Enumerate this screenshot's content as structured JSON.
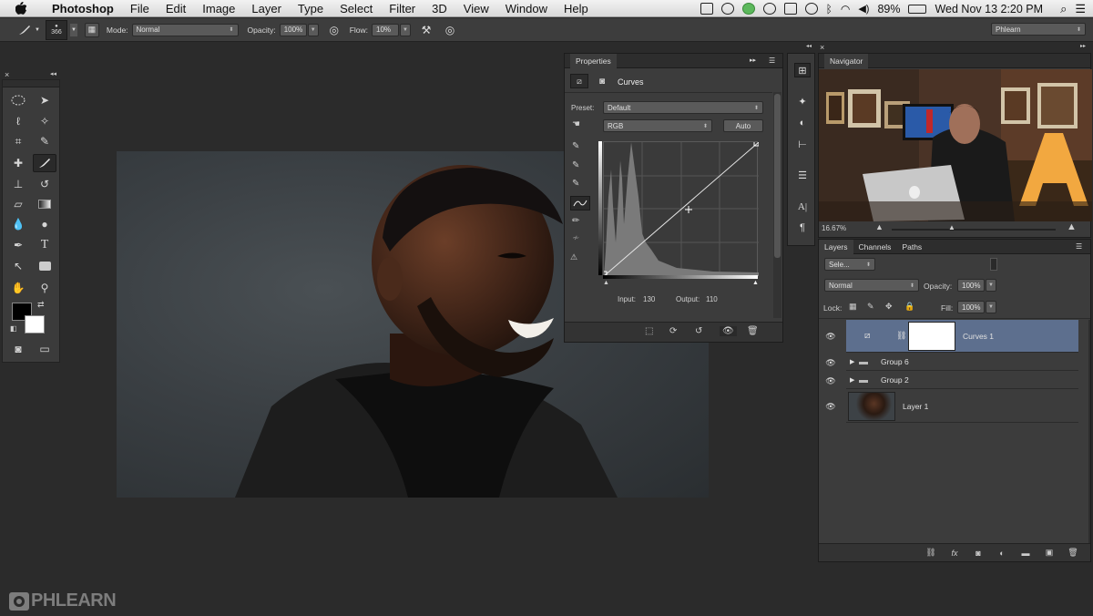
{
  "menubar": {
    "app": "Photoshop",
    "items": [
      "File",
      "Edit",
      "Image",
      "Layer",
      "Type",
      "Select",
      "Filter",
      "3D",
      "View",
      "Window",
      "Help"
    ],
    "battery": "89%",
    "clock": "Wed Nov 13  2:20 PM"
  },
  "options": {
    "brush_size": "366",
    "mode_label": "Mode:",
    "mode_value": "Normal",
    "opacity_label": "Opacity:",
    "opacity_value": "100%",
    "flow_label": "Flow:",
    "flow_value": "10%",
    "workspace": "Phlearn"
  },
  "properties": {
    "tab": "Properties",
    "title": "Curves",
    "preset_label": "Preset:",
    "preset_value": "Default",
    "channel": "RGB",
    "auto": "Auto",
    "input_label": "Input:",
    "input_value": "130",
    "output_label": "Output:",
    "output_value": "110"
  },
  "navigator": {
    "tab": "Navigator",
    "zoom": "16.67%"
  },
  "layers": {
    "tabs": [
      "Layers",
      "Channels",
      "Paths"
    ],
    "search": "Sele...",
    "blend": "Normal",
    "opacity_label": "Opacity:",
    "opacity_value": "100%",
    "lock_label": "Lock:",
    "fill_label": "Fill:",
    "fill_value": "100%",
    "rows": [
      {
        "name": "Curves 1"
      },
      {
        "name": "Group 6"
      },
      {
        "name": "Group 2"
      },
      {
        "name": "Layer 1"
      }
    ]
  },
  "watermark": "PHLEARN",
  "colors": {
    "selected_layer": "#5d6f8e",
    "panel": "#3c3c3c",
    "canvas_bg": "#2b2b2b"
  }
}
